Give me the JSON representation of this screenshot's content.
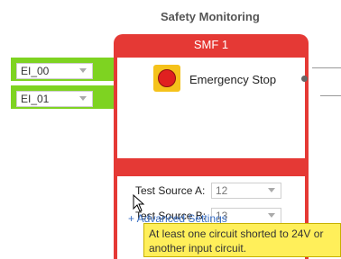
{
  "title": "Safety Monitoring",
  "inputs": [
    {
      "label": "EI_00"
    },
    {
      "label": "EI_01"
    }
  ],
  "block": {
    "name": "SMF 1",
    "item": "Emergency Stop",
    "test_a_label": "Test Source A:",
    "test_a_value": "12",
    "test_b_label": "Test Source B:",
    "test_b_value": "13",
    "advanced": "+ Advanced Settings"
  },
  "tooltip": "At least one circuit shorted to 24V or another input circuit.",
  "colors": {
    "accent": "#e53935",
    "input": "#7ed321",
    "tooltip_bg": "#ffef5a"
  }
}
